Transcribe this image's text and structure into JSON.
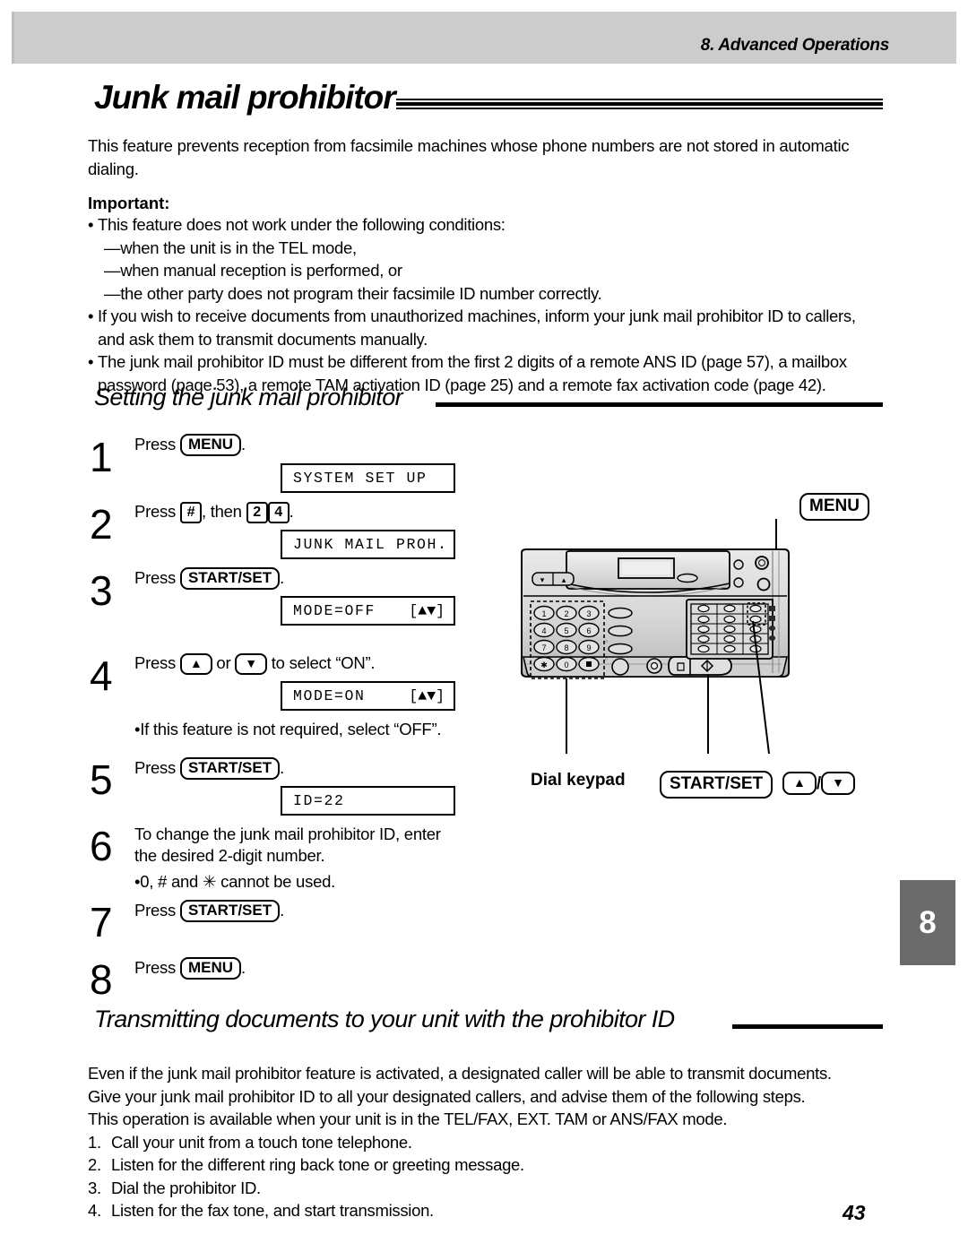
{
  "header": {
    "running_head": "8.  Advanced Operations"
  },
  "chapter": {
    "title": "Junk mail prohibitor",
    "thumb_tab": "8",
    "page_number": "43"
  },
  "intro": {
    "paragraph": "This feature prevents reception from facsimile machines whose phone numbers are not stored in automatic dialing."
  },
  "important": {
    "label": "Important:",
    "items": [
      "This feature does not work under the following conditions:",
      "—when the unit is in the TEL mode,",
      "—when manual reception is performed, or",
      "—the other party does not program their facsimile ID number correctly.",
      "If you wish to receive documents from unauthorized machines, inform your junk mail prohibitor ID to callers, and ask them to transmit documents manually.",
      "The junk mail prohibitor ID must be different from the first 2 digits of a remote ANS ID (page 57), a mailbox password (page 53), a remote TAM activation ID (page 25) and a remote fax activation code (page 42)."
    ]
  },
  "section_setting": {
    "heading": "Setting the junk mail prohibitor",
    "steps": [
      {
        "num": "1",
        "prefix": "Press ",
        "key": "MENU",
        "suffix": ".",
        "lcd": "SYSTEM SET UP"
      },
      {
        "num": "2",
        "prefix": "Press ",
        "key_hash": "#",
        "mid": ", then ",
        "key_2": "2",
        "key_4": "4",
        "suffix": ".",
        "lcd": "JUNK MAIL PROH."
      },
      {
        "num": "3",
        "prefix": "Press ",
        "key": "START/SET",
        "suffix": ".",
        "lcd": "MODE=OFF",
        "lcd_right": "[▲▼]"
      },
      {
        "num": "4",
        "prefix": "Press ",
        "key_up": "▲",
        "mid": " or ",
        "key_down": "▼",
        "suffix": " to select “ON”.",
        "lcd": "MODE=ON",
        "lcd_right": "[▲▼]",
        "note": "If this feature is not required, select “OFF”."
      },
      {
        "num": "5",
        "prefix": "Press ",
        "key": "START/SET",
        "suffix": ".",
        "lcd": "ID=22"
      },
      {
        "num": "6",
        "text": "To change the junk mail prohibitor ID, enter the desired 2-digit number.",
        "note": "0, # and ✳ cannot be used."
      },
      {
        "num": "7",
        "prefix": "Press ",
        "key": "START/SET",
        "suffix": "."
      },
      {
        "num": "8",
        "prefix": "Press ",
        "key": "MENU",
        "suffix": "."
      }
    ]
  },
  "illustration": {
    "callout_menu": "MENU",
    "callout_dial_keypad": "Dial keypad",
    "callout_start_set": "START/SET",
    "callout_updown_up": "▲",
    "callout_updown_sep": "/",
    "callout_updown_down": "▼",
    "keypad_keys": [
      "1",
      "2",
      "3",
      "4",
      "5",
      "6",
      "7",
      "8",
      "9",
      "✳",
      "0",
      "■"
    ]
  },
  "section_transmit": {
    "heading": "Transmitting documents to your unit with the prohibitor ID",
    "paragraphs": [
      "Even if the junk mail prohibitor feature is activated, a designated caller will be able to transmit documents.",
      "Give your junk mail prohibitor ID to all your designated callers, and advise them of the following steps.",
      "This operation is available when your unit is in the TEL/FAX, EXT. TAM or ANS/FAX mode."
    ],
    "steps": [
      {
        "n": "1.",
        "t": "Call your unit from a touch tone telephone."
      },
      {
        "n": "2.",
        "t": "Listen for the different ring back tone or greeting message."
      },
      {
        "n": "3.",
        "t": "Dial the prohibitor ID."
      },
      {
        "n": "4.",
        "t": "Listen for the fax tone, and start transmission."
      }
    ]
  },
  "colors": {
    "header_bar": "#cccccc",
    "thumb_tab": "#6b6b6b",
    "ink": "#000000",
    "panel_light": "#e8e8e8",
    "panel_mid": "#c9c9c9",
    "panel_dark": "#a8a8a8"
  }
}
